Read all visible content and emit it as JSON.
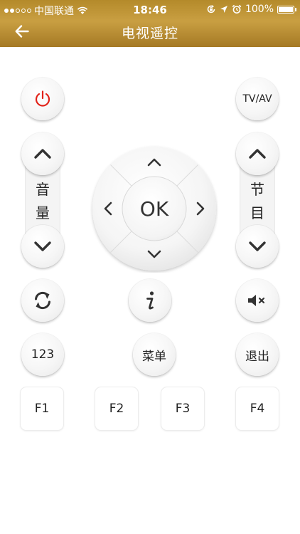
{
  "status_bar": {
    "carrier": "中国联通",
    "time": "18:46",
    "battery_text": "100%",
    "battery_level": 1.0,
    "icons": [
      "signal-dots-icon",
      "wifi-icon",
      "rotation-lock-icon",
      "location-arrow-icon",
      "alarm-icon",
      "battery-icon"
    ]
  },
  "nav": {
    "title": "电视遥控",
    "back_icon": "arrow-left-icon"
  },
  "remote": {
    "power_icon": "power-icon",
    "power_color": "#e2231a",
    "tvav_label": "TV/AV",
    "volume_label_1": "音",
    "volume_label_2": "量",
    "channel_label_1": "节",
    "channel_label_2": "目",
    "ok_label": "OK",
    "info_icon": "info-icon",
    "refresh_icon": "refresh-icon",
    "mute_icon": "mute-icon",
    "num_label": "123",
    "menu_label": "菜单",
    "exit_label": "退出",
    "f1_label": "F1",
    "f2_label": "F2",
    "f3_label": "F3",
    "f4_label": "F4"
  },
  "colors": {
    "header_gold": "#b48a2a",
    "icon_dark": "#333333"
  }
}
